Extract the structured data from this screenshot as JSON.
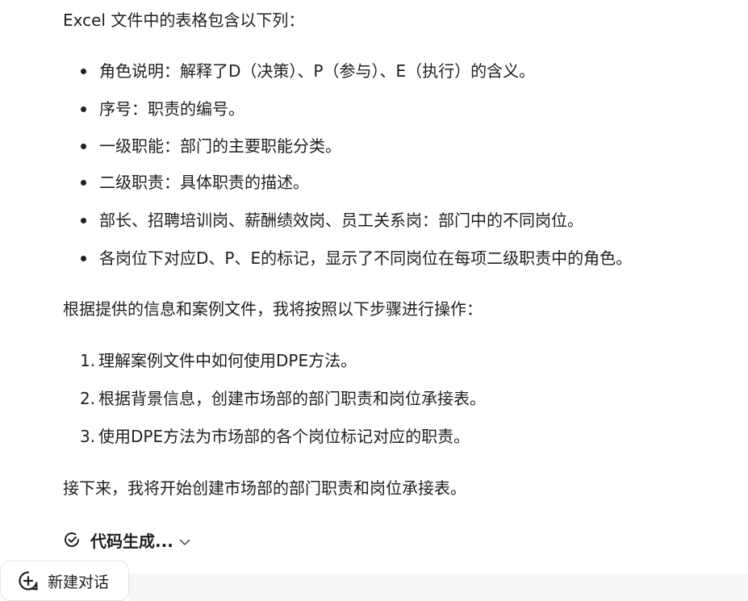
{
  "message": {
    "intro": "Excel 文件中的表格包含以下列：",
    "columns": [
      "角色说明：解释了D（决策）、P（参与）、E（执行）的含义。",
      "序号：职责的编号。",
      "一级职能：部门的主要职能分类。",
      "二级职责：具体职责的描述。",
      "部长、招聘培训岗、薪酬绩效岗、员工关系岗：部门中的不同岗位。",
      "各岗位下对应D、P、E的标记，显示了不同岗位在每项二级职责中的角色。"
    ],
    "plan_intro": "根据提供的信息和案例文件，我将按照以下步骤进行操作：",
    "steps": [
      {
        "marker": "1.",
        "text": "理解案例文件中如何使用DPE方法。"
      },
      {
        "marker": "2.",
        "text": "根据背景信息，创建市场部的部门职责和岗位承接表。"
      },
      {
        "marker": "3.",
        "text": "使用DPE方法为市场部的各个岗位标记对应的职责。"
      }
    ],
    "next_text": "接下来，我将开始创建市场部的部门职责和岗位承接表。"
  },
  "code_status": {
    "icon": "check-circle-icon",
    "label": "代码生成...",
    "chevron": "chevron-down-icon"
  },
  "new_chat": {
    "icon": "plus-circle-icon",
    "label": "新建对话"
  },
  "colors": {
    "text": "#1f1f1f",
    "muted_bg": "#f7f7f8",
    "border": "#e3e3e3"
  }
}
